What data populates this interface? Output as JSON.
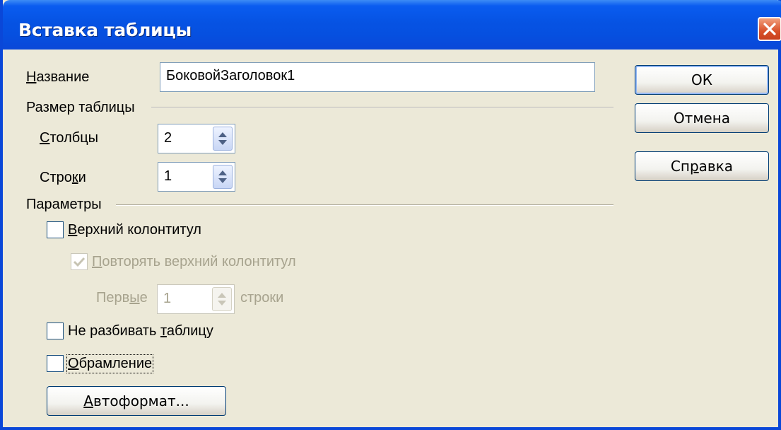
{
  "window": {
    "title": "Вставка таблицы"
  },
  "name": {
    "label": "Название",
    "value": "БоковойЗаголовок1"
  },
  "size_section": {
    "heading": "Размер таблицы"
  },
  "columns": {
    "label": "Столбцы",
    "value": "2"
  },
  "rows": {
    "label": "Строки",
    "value": "1"
  },
  "params_section": {
    "heading": "Параметры"
  },
  "options": {
    "header": {
      "label": "Верхний колонтитул",
      "checked": false
    },
    "repeat_header": {
      "label": "Повторять верхний колонтитул",
      "checked": true,
      "enabled": false
    },
    "first": {
      "prefix": "Первые",
      "value": "1",
      "suffix": "строки"
    },
    "no_split": {
      "label": "Не разбивать таблицу",
      "checked": false
    },
    "border": {
      "label": "Обрамление",
      "checked": false
    }
  },
  "buttons": {
    "ok": "ОК",
    "cancel": "Отмена",
    "help": "Справка",
    "autoformat": "Автоформат..."
  }
}
